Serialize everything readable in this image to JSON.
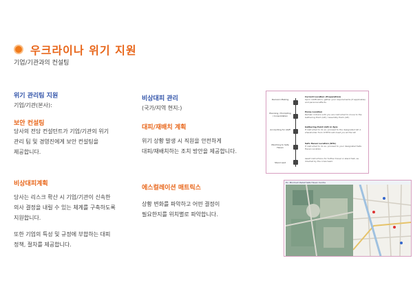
{
  "header": {
    "title": "우크라이나 위기 지원",
    "subtitle": "기업/기관과의 컨설팅"
  },
  "left": {
    "team_heading": "위기 관리팀 지원",
    "team_sub": "기업/기관(본사):",
    "security_heading": "보안 컨설팅",
    "security_body": [
      "당사의 전담 컨설턴트가 기업/기관의 위기",
      "관리 팀 및 경영진에게 보안 컨설팅을",
      "제공합니다."
    ],
    "emergency_heading": "비상대피계획",
    "emergency_body": [
      "당사는 리스크 확산 시 기업/기관이 신속한",
      "의사 결정을 내릴 수 있는 체계를 구축하도록",
      "지원합니다."
    ],
    "emergency_body2": [
      "또한 기업의 특성 및 규정에 부합하는 대피",
      "정책, 절차를 제공합니다."
    ]
  },
  "middle": {
    "mgmt_heading": "비상대피 관리",
    "mgmt_sub": "(국가/지역 현지:)",
    "relocation_heading": "대피/재배치 계획",
    "relocation_body": [
      "위기 상황 발생 시 직원을 안전하게",
      "대피/재배치하는 조치 방안을 제공합니다."
    ],
    "escalation_heading": "에스컬레이션 매트릭스",
    "escalation_body": [
      "상황 변화를 파악하고 어떤 결정이",
      "필요한지를 위치별로 파악합니다."
    ]
  },
  "diagram": {
    "steps": [
      {
        "label": "Decision Making"
      },
      {
        "label": "Planning / Prompting / Consolidation"
      },
      {
        "label": "Accounting for staff"
      },
      {
        "label": "Marching to Safe Haven"
      },
      {
        "label": "Stand Last"
      }
    ],
    "notes": [
      {
        "title": "Current Location (Preparation)",
        "text": "Upon notification, gather your requirements (if applicable) and personal effects."
      },
      {
        "title": "Home Location",
        "text": "Remain indoors until you are instructed to move to the Gathering Point (GP) / Assembly Point (AP)."
      },
      {
        "title": "Gathering Point (GP) in Kyiv",
        "text": "If instructed to do so, proceed to the designated GP. A shareholder from XYMTO will meet you at the GP."
      },
      {
        "title": "Safe Haven Location (SHL)",
        "text": "If instructed to do so, proceed to your designated Safe Haven Location."
      },
      {
        "title": "",
        "text": "Await instructions for further travel or stand fast, as directed by the crisis team."
      }
    ]
  },
  "map": {
    "header": "Ex. Minimum Relief Safe Haven Centre",
    "items": [
      "Hotel / Landmark",
      "Hospital",
      "Embassy",
      "Airport"
    ]
  }
}
